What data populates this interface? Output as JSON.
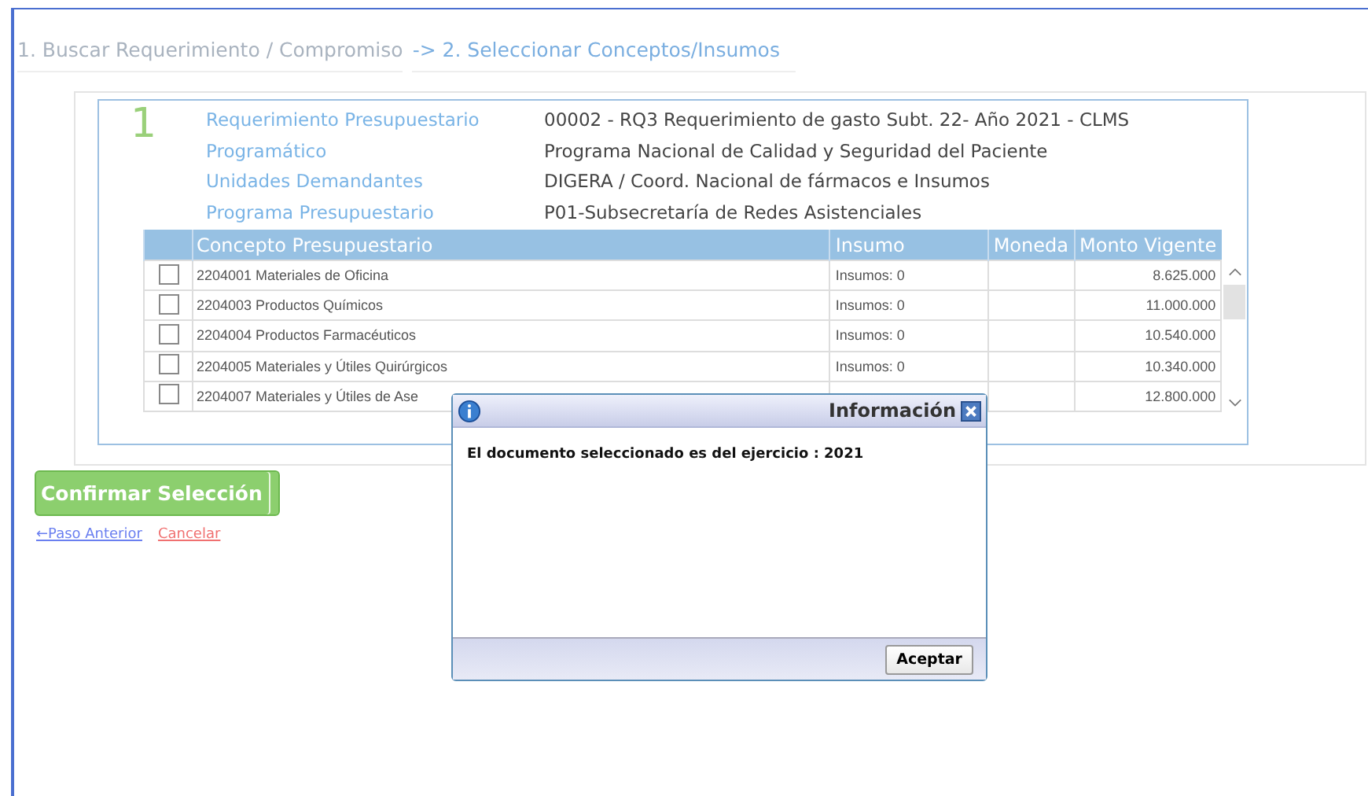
{
  "steps": [
    {
      "label": "1. Buscar Requerimiento / Compromiso",
      "selected": false
    },
    {
      "label": "-> 2. Seleccionar Conceptos/Insumos",
      "selected": true
    }
  ],
  "panel": {
    "number": "1",
    "fields": [
      {
        "label": "Requerimiento Presupuestario",
        "value": "00002 - RQ3 Requerimiento de gasto Subt. 22- Año 2021 - CLMS"
      },
      {
        "label": "Programático",
        "value": "Programa Nacional de Calidad y Seguridad del Paciente"
      },
      {
        "label": "Unidades Demandantes",
        "value": "DIGERA / Coord. Nacional de fármacos e Insumos"
      },
      {
        "label": "Programa Presupuestario",
        "value": "P01-Subsecretaría de Redes Asistenciales"
      }
    ]
  },
  "table": {
    "columns": [
      "Concepto Presupuestario",
      "Insumo",
      "Moneda",
      "Monto Vigente"
    ],
    "rows": [
      {
        "checked": false,
        "concepto": "2204001 Materiales de Oficina",
        "insumo": "Insumos: 0",
        "moneda": "",
        "monto": "8.625.000"
      },
      {
        "checked": false,
        "concepto": "2204003 Productos Químicos",
        "insumo": "Insumos: 0",
        "moneda": "",
        "monto": "11.000.000"
      },
      {
        "checked": false,
        "concepto": "2204004 Productos Farmacéuticos",
        "insumo": "Insumos: 0",
        "moneda": "",
        "monto": "10.540.000"
      },
      {
        "checked": false,
        "concepto": "2204005 Materiales y Útiles Quirúrgicos",
        "insumo": "Insumos: 0",
        "moneda": "",
        "monto": "10.340.000"
      },
      {
        "checked": false,
        "concepto": "2204007 Materiales y Útiles de Ase",
        "insumo": "",
        "moneda": "",
        "monto": "12.800.000"
      }
    ]
  },
  "confirm_button": "Confirmar Selección",
  "links": [
    {
      "label": "←Paso Anterior",
      "kind": "back"
    },
    {
      "label": "Cancelar",
      "kind": "cancel"
    }
  ],
  "dialog": {
    "title": "Información",
    "message": "El documento seleccionado es del ejercicio : 2021",
    "button": "Aceptar"
  }
}
